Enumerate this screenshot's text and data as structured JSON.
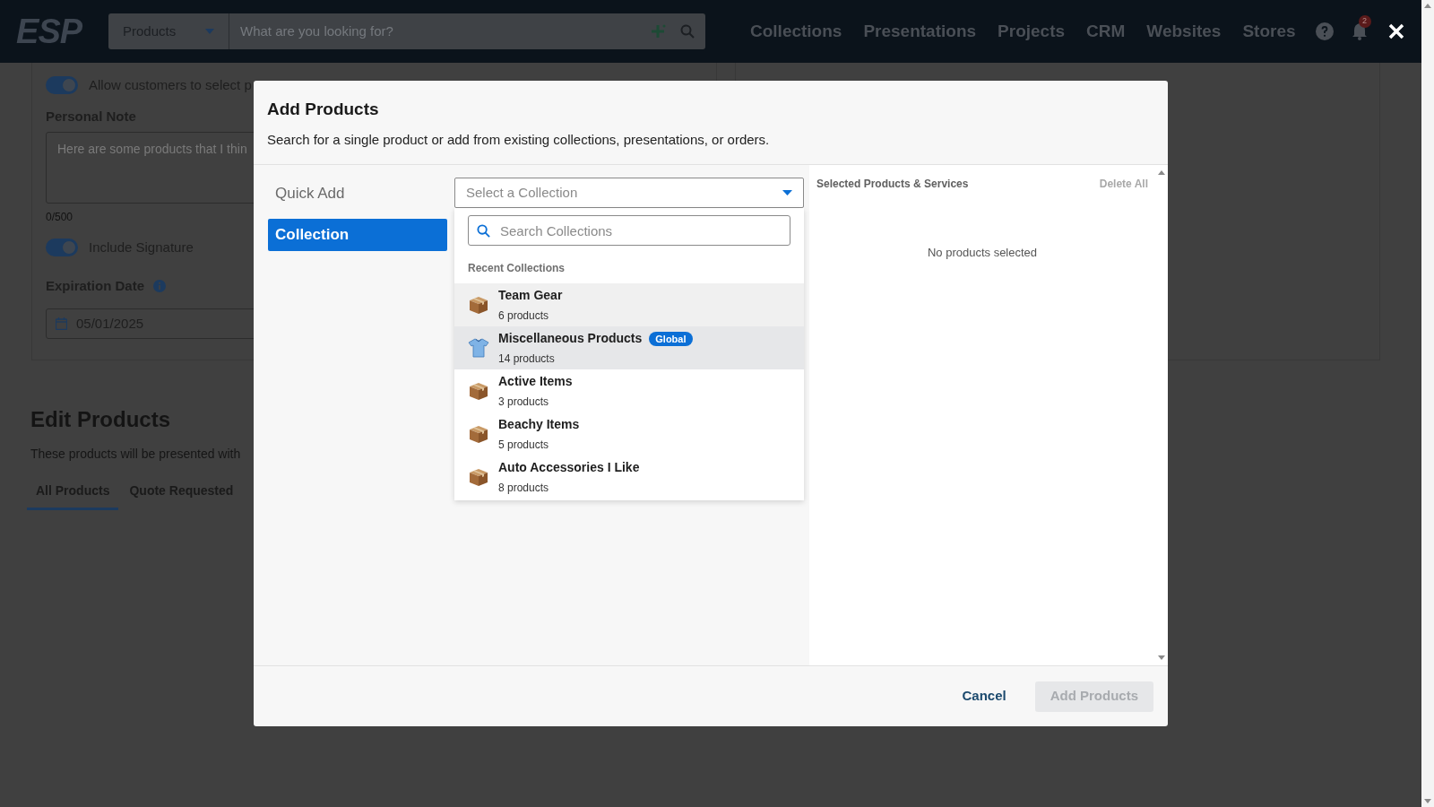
{
  "header": {
    "logo": "ESP",
    "search": {
      "category": "Products",
      "placeholder": "What are you looking for?"
    },
    "nav": [
      "Collections",
      "Presentations",
      "Projects",
      "CRM",
      "Websites",
      "Stores"
    ],
    "notifications": "2"
  },
  "page": {
    "allow_toggle": {
      "label": "Allow customers to select p",
      "on": true
    },
    "personal_note": {
      "label": "Personal Note",
      "placeholder": "Here are some products that I thin",
      "count": "0/500"
    },
    "signature_toggle": {
      "label": "Include Signature",
      "on": true
    },
    "expiration": {
      "label": "Expiration Date",
      "value": "05/01/2025"
    },
    "edit": {
      "title": "Edit Products",
      "subtitle": "These products will be presented with",
      "tabs": [
        {
          "label": "All Products",
          "selected": true
        },
        {
          "label": "Quote Requested",
          "selected": false
        }
      ]
    }
  },
  "modal": {
    "title": "Add Products",
    "subtitle": "Search for a single product or add from existing collections, presentations, or orders.",
    "modes": [
      {
        "label": "Quick Add",
        "selected": false
      },
      {
        "label": "Collection",
        "selected": true
      }
    ],
    "select": {
      "placeholder": "Select a Collection"
    },
    "search": {
      "placeholder": "Search Collections"
    },
    "recent_heading": "Recent Collections",
    "collections": [
      {
        "name": "Team Gear",
        "count": "6 products",
        "kind": "box",
        "hovered": true,
        "selected": false
      },
      {
        "name": "Miscellaneous Products",
        "count": "14 products",
        "kind": "shirt",
        "badge": "Global",
        "hovered": false,
        "selected": true
      },
      {
        "name": "Active Items",
        "count": "3 products",
        "kind": "box",
        "hovered": false,
        "selected": false
      },
      {
        "name": "Beachy Items",
        "count": "5 products",
        "kind": "box",
        "hovered": false,
        "selected": false
      },
      {
        "name": "Auto Accessories I Like",
        "count": "8 products",
        "kind": "box",
        "hovered": false,
        "selected": false
      }
    ],
    "selected_panel": {
      "title": "Selected Products & Services",
      "delete_all": "Delete All",
      "empty": "No products selected"
    },
    "buttons": {
      "cancel": "Cancel",
      "add": {
        "label": "Add Products",
        "disabled": true
      }
    }
  }
}
